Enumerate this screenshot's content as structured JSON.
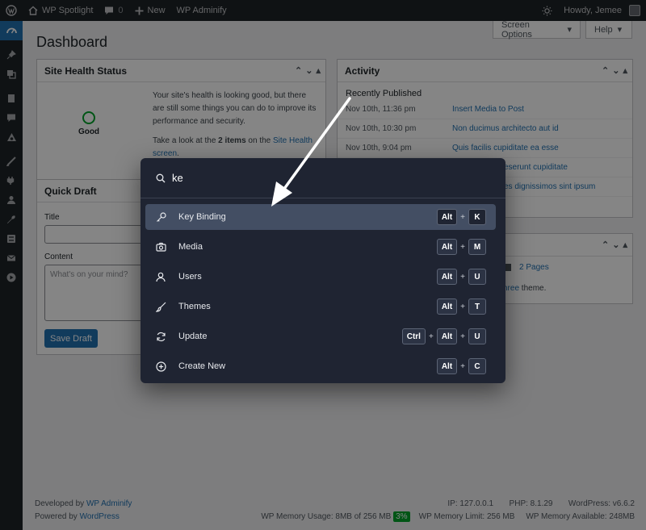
{
  "adminbar": {
    "site_name": "WP Spotlight",
    "comments_count": "0",
    "new_label": "New",
    "plugin_link": "WP Adminify",
    "greeting": "Howdy, Jemee"
  },
  "screen_meta": {
    "options": "Screen Options",
    "help": "Help"
  },
  "page_title": "Dashboard",
  "site_health": {
    "title": "Site Health Status",
    "status": "Good",
    "text1": "Your site's health is looking good, but there are still some things you can do to improve its performance and security.",
    "text2_prefix": "Take a look at the",
    "items": "2 items",
    "text2_mid": "on the",
    "link": "Site Health screen",
    "period": "."
  },
  "quick_draft": {
    "title": "Quick Draft",
    "title_label": "Title",
    "content_label": "Content",
    "content_placeholder": "What's on your mind?",
    "save": "Save Draft"
  },
  "activity": {
    "title": "Activity",
    "recent_title": "Recently Published",
    "rows": [
      {
        "date": "Nov 10th, 11:36 pm",
        "title": "Insert Media to Post"
      },
      {
        "date": "Nov 10th, 10:30 pm",
        "title": "Non ducimus architecto aut id"
      },
      {
        "date": "Nov 10th, 9:04 pm",
        "title": "Quis facilis cupiditate ea esse"
      },
      {
        "date": "",
        "title": "eserunt cupiditate"
      },
      {
        "date": "",
        "title": "es dignissimos sint ipsum"
      }
    ]
  },
  "glance": {
    "pages": "2 Pages",
    "theme_link": "hree",
    "theme_suffix": " theme."
  },
  "footer": {
    "developed_by": "Developed by",
    "dev_link": "WP Adminify",
    "powered_by": "Powered by",
    "wp_link": "WordPress",
    "ip": "IP: 127.0.0.1",
    "php": "PHP: 8.1.29",
    "wp_version": "WordPress: v6.6.2",
    "memory_usage": "WP Memory Usage: 8MB of 256 MB",
    "memory_pct": "3%",
    "memory_limit": "WP Memory Limit: 256 MB",
    "memory_available": "WP Memory Available: 248MB"
  },
  "palette": {
    "query": "ke",
    "commands": [
      {
        "label": "Key Binding",
        "icon": "key-icon",
        "keys": [
          "Alt",
          "K"
        ]
      },
      {
        "label": "Media",
        "icon": "camera-icon",
        "keys": [
          "Alt",
          "M"
        ]
      },
      {
        "label": "Users",
        "icon": "user-icon",
        "keys": [
          "Alt",
          "U"
        ]
      },
      {
        "label": "Themes",
        "icon": "brush-icon",
        "keys": [
          "Alt",
          "T"
        ]
      },
      {
        "label": "Update",
        "icon": "refresh-icon",
        "keys": [
          "Ctrl",
          "Alt",
          "U"
        ]
      },
      {
        "label": "Create New",
        "icon": "plus-circle-icon",
        "keys": [
          "Alt",
          "C"
        ]
      }
    ],
    "plus": "+"
  },
  "colors": {
    "accent": "#2271b1",
    "adminbar": "#1d2327",
    "palette_bg": "#1f2432",
    "active_row": "#434e63",
    "health_good": "#00a32a"
  }
}
